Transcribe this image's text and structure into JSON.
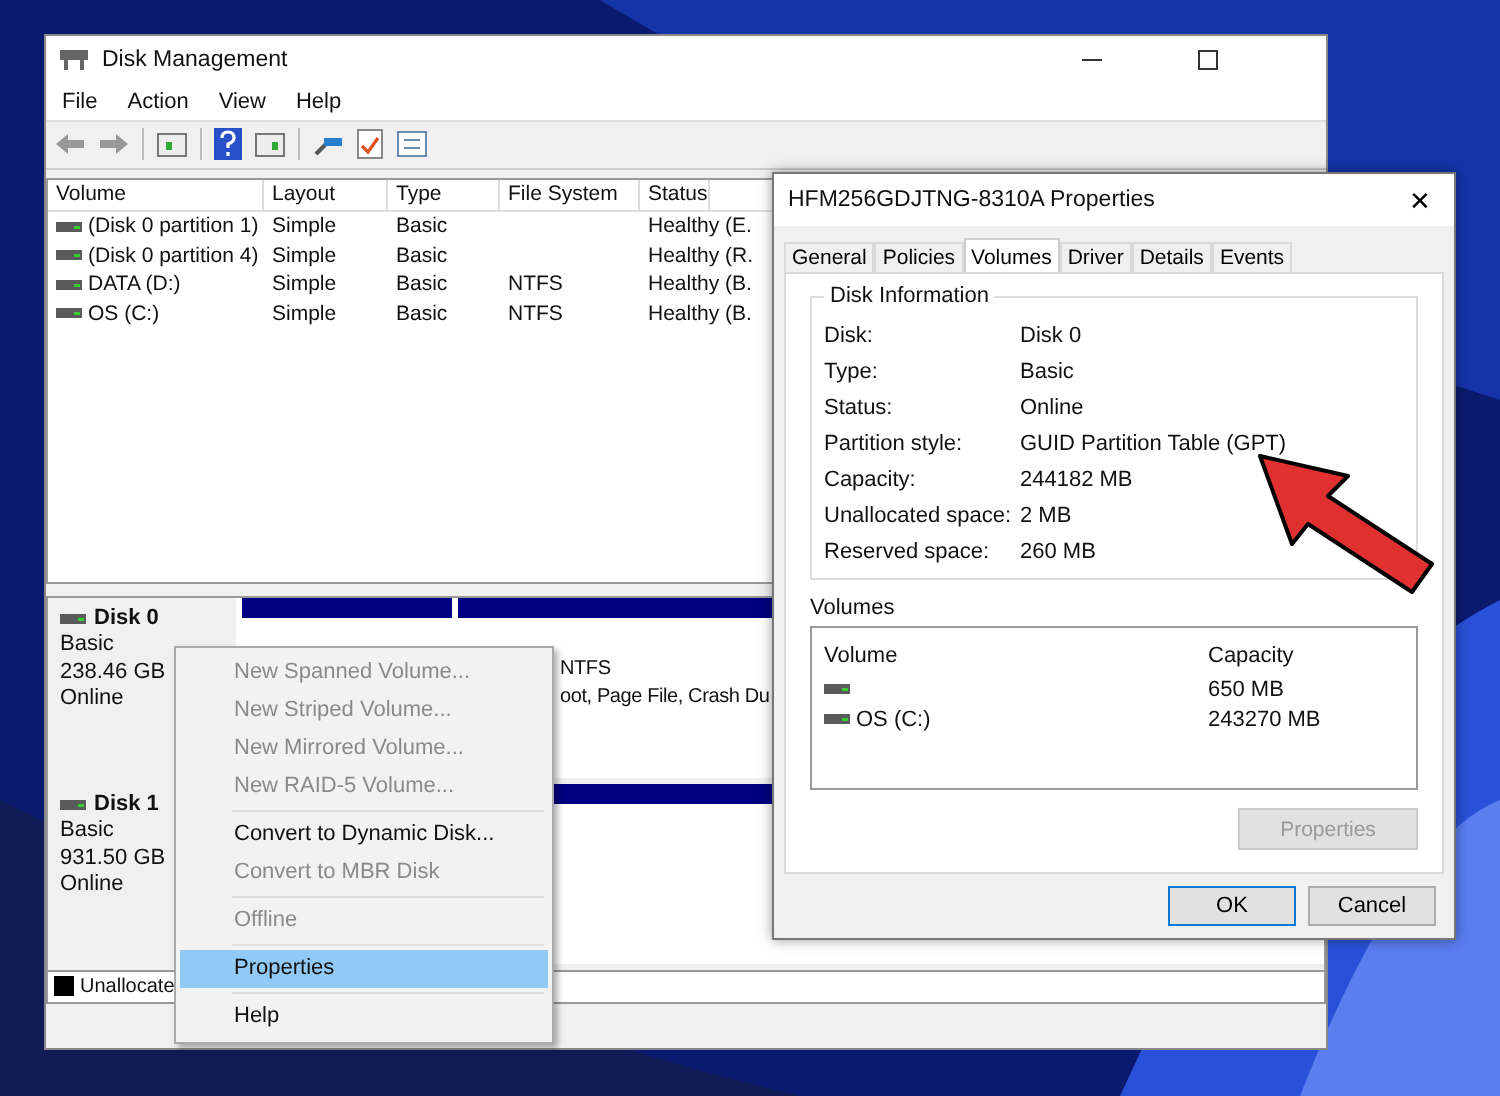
{
  "main_window": {
    "title": "Disk Management",
    "menu": [
      "File",
      "Action",
      "View",
      "Help"
    ],
    "volume_table": {
      "columns": [
        "Volume",
        "Layout",
        "Type",
        "File System",
        "Status"
      ],
      "rows": [
        {
          "volume": "(Disk 0 partition 1)",
          "layout": "Simple",
          "type": "Basic",
          "status": "Healthy (E."
        },
        {
          "volume": "(Disk 0 partition 4)",
          "layout": "Simple",
          "type": "Basic",
          "status": "Healthy (R."
        },
        {
          "volume": "DATA (D:)",
          "layout": "Simple",
          "type": "Basic",
          "file_system": "NTFS",
          "status": "Healthy (B."
        },
        {
          "volume": "OS (C:)",
          "layout": "Simple",
          "type": "Basic",
          "file_system": "NTFS",
          "status": "Healthy (B."
        }
      ]
    },
    "disks": [
      {
        "name": "Disk 0",
        "type": "Basic",
        "size": "238.46 GB",
        "status": "Online",
        "partitions": [
          {
            "kind": "blank"
          },
          {
            "kind": "text",
            "file_system": "NTFS",
            "status": "oot, Page File, Crash Du"
          }
        ]
      },
      {
        "name": "Disk 1",
        "type": "Basic",
        "size": "931.50 GB",
        "status": "Online",
        "partitions": [
          {
            "kind": "blank"
          }
        ]
      }
    ],
    "legend": [
      {
        "label": "Unallocate",
        "color": "#000000"
      }
    ]
  },
  "context_menu": [
    {
      "kind": "item",
      "label": "New Spanned Volume...",
      "disabled": true,
      "selected": false
    },
    {
      "kind": "item",
      "label": "New Striped Volume...",
      "disabled": true,
      "selected": false
    },
    {
      "kind": "item",
      "label": "New Mirrored Volume...",
      "disabled": true,
      "selected": false
    },
    {
      "kind": "item",
      "label": "New RAID-5 Volume...",
      "disabled": true,
      "selected": false
    },
    {
      "kind": "separator"
    },
    {
      "kind": "item",
      "label": "Convert to Dynamic Disk...",
      "disabled": false,
      "selected": false
    },
    {
      "kind": "item",
      "label": "Convert to MBR Disk",
      "disabled": true,
      "selected": false
    },
    {
      "kind": "separator"
    },
    {
      "kind": "item",
      "label": "Offline",
      "disabled": true,
      "selected": false
    },
    {
      "kind": "separator"
    },
    {
      "kind": "item",
      "label": "Properties",
      "disabled": false,
      "selected": true
    },
    {
      "kind": "separator"
    },
    {
      "kind": "item",
      "label": "Help",
      "disabled": false,
      "selected": false
    }
  ],
  "dialog": {
    "title": "HFM256GDJTNG-8310A Properties",
    "close": "✕",
    "tabs": [
      {
        "label": "General",
        "selected": false
      },
      {
        "label": "Policies",
        "selected": false
      },
      {
        "label": "Volumes",
        "selected": true
      },
      {
        "label": "Driver",
        "selected": false
      },
      {
        "label": "Details",
        "selected": false
      },
      {
        "label": "Events",
        "selected": false
      }
    ],
    "disk_information": {
      "title": "Disk Information",
      "fields": [
        {
          "label": "Disk:",
          "value": "Disk 0"
        },
        {
          "label": "Type:",
          "value": "Basic"
        },
        {
          "label": "Status:",
          "value": "Online"
        },
        {
          "label": "Partition style:",
          "value": "GUID Partition Table (GPT)"
        },
        {
          "label": "Capacity:",
          "value": "244182 MB"
        },
        {
          "label": "Unallocated space:",
          "value": "2 MB"
        },
        {
          "label": "Reserved space:",
          "value": "260 MB"
        }
      ]
    },
    "volumes": {
      "title": "Volumes",
      "columns": [
        "Volume",
        "Capacity"
      ],
      "rows": [
        {
          "capacity": "650 MB"
        },
        {
          "volume": "OS (C:)",
          "capacity": "243270 MB"
        }
      ]
    },
    "properties_button": {
      "label": "Properties",
      "disabled": true
    },
    "buttons": [
      {
        "label": "OK",
        "selected": true
      },
      {
        "label": "Cancel",
        "selected": false
      }
    ]
  }
}
